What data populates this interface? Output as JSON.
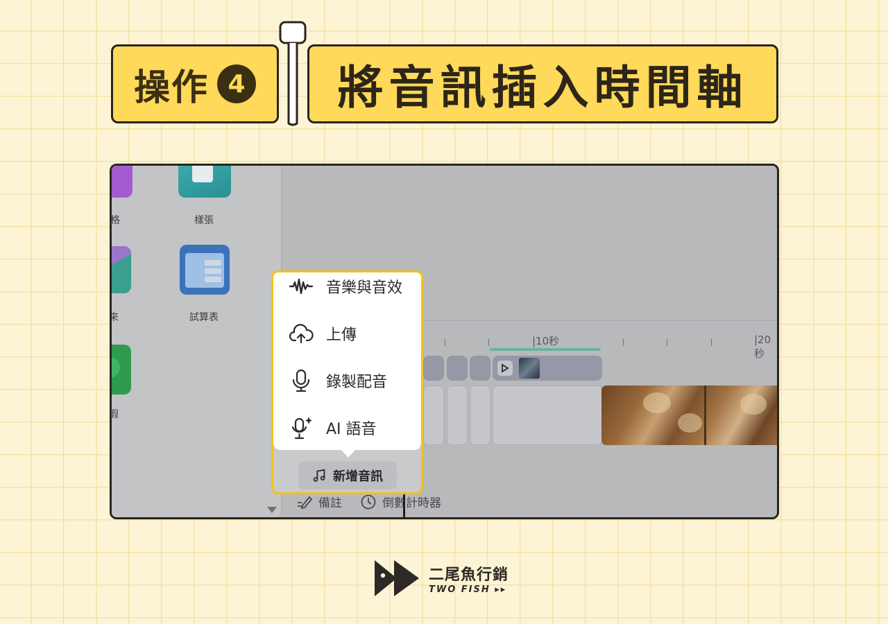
{
  "header": {
    "step_label": "操作",
    "step_number": "4",
    "title": "將音訊插入時間軸"
  },
  "left_panel": {
    "items": [
      {
        "label": "樣張",
        "icon": "sticker-sheet-icon"
      },
      {
        "label": "試算表",
        "icon": "spreadsheet-icon"
      }
    ],
    "partial_labels": [
      "格",
      "來",
      "瑕"
    ]
  },
  "timeline": {
    "ruler_labels": [
      "|10秒",
      "|20秒"
    ]
  },
  "popup_menu": {
    "items": [
      {
        "label": "音樂與音效",
        "icon": "waveform-icon"
      },
      {
        "label": "上傳",
        "icon": "cloud-upload-icon"
      },
      {
        "label": "錄製配音",
        "icon": "microphone-icon"
      },
      {
        "label": "AI 語音",
        "icon": "ai-voice-icon"
      }
    ],
    "add_audio_button": "新增音訊",
    "add_audio_icon": "music-note-icon"
  },
  "bottom_bar": {
    "notes_label": "備註",
    "timer_label": "倒數計時器"
  },
  "brand": {
    "name": "二尾魚行銷",
    "subtitle": "TWO FISH ▸▸"
  },
  "colors": {
    "background": "#fdf4d6",
    "accent_yellow": "#ffd95a",
    "highlight_border": "#f3c21a",
    "dark": "#2a241c"
  }
}
